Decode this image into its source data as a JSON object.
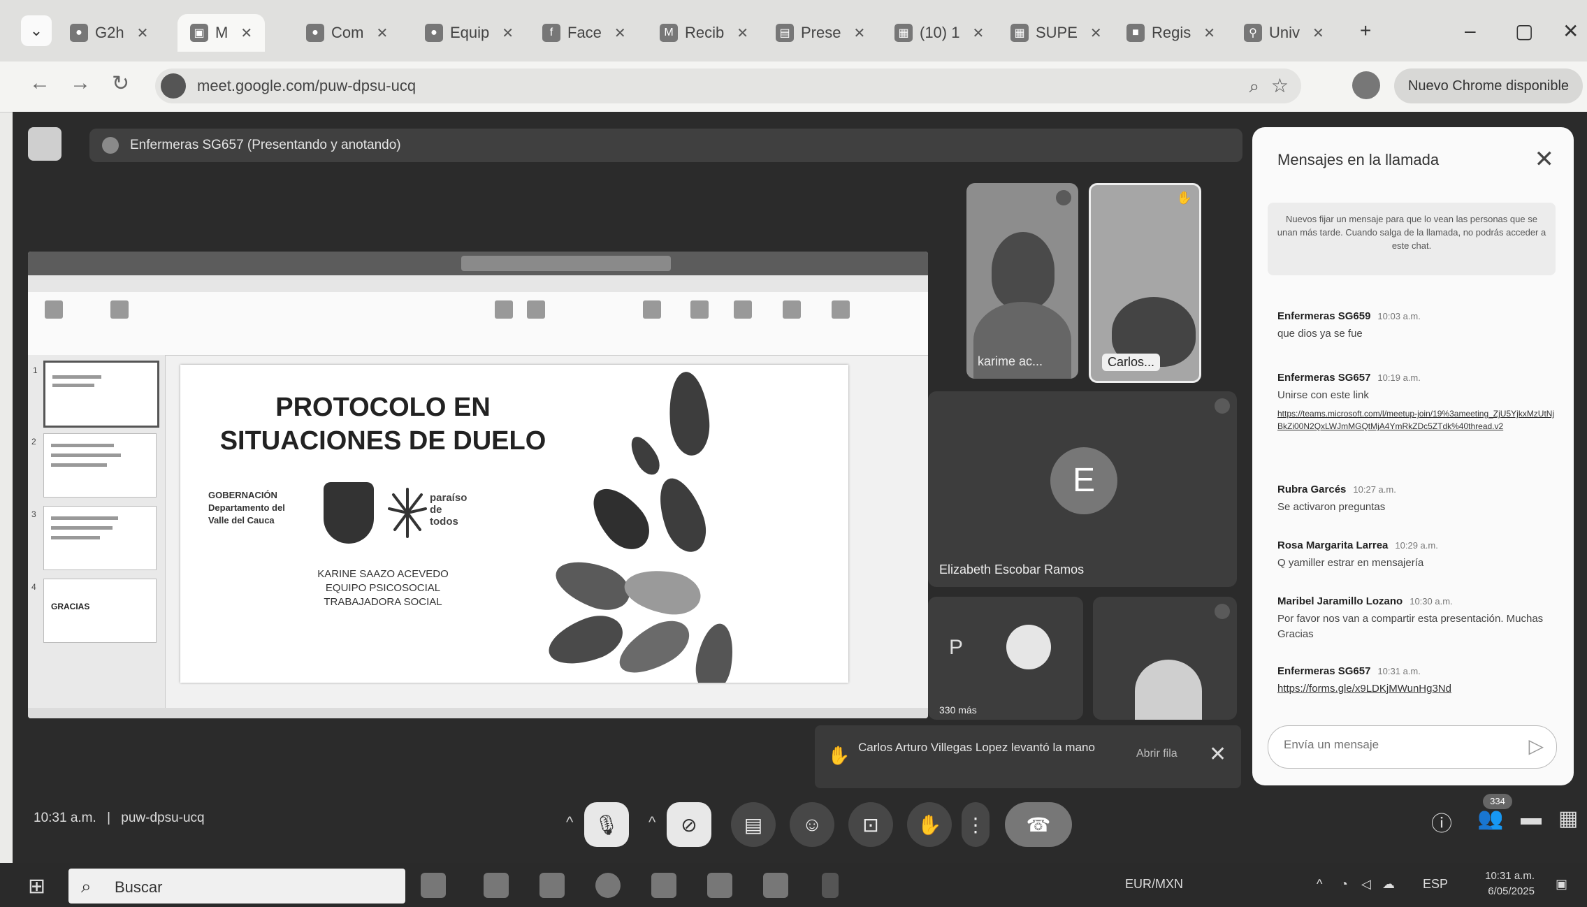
{
  "browser": {
    "tabs": [
      {
        "label": "G2h",
        "icon": "generic-tab-icon"
      },
      {
        "label": "M",
        "icon": "meet-icon",
        "active": true
      },
      {
        "label": "Com",
        "icon": "generic-tab-icon"
      },
      {
        "label": "Equip",
        "icon": "generic-tab-icon"
      },
      {
        "label": "Face",
        "icon": "facebook-icon"
      },
      {
        "label": "Recib",
        "icon": "gmail-icon"
      },
      {
        "label": "Prese",
        "icon": "slides-icon"
      },
      {
        "label": "(10) 1",
        "icon": "generic-tab-icon"
      },
      {
        "label": "SUPE",
        "icon": "generic-tab-icon"
      },
      {
        "label": "Regis",
        "icon": "generic-tab-icon"
      },
      {
        "label": "Univ",
        "icon": "maps-icon"
      }
    ],
    "url": "meet.google.com/puw-dpsu-ucq",
    "update_label": "Nuevo Chrome disponible"
  },
  "meet": {
    "presenting_label": "Enfermeras SG657 (Presentando y anotando)",
    "slide": {
      "title_line1": "PROTOCOLO EN",
      "title_line2": "SITUACIONES DE DUELO",
      "gob_line1": "GOBERNACIÓN",
      "gob_line2": "Departamento del",
      "gob_line3": "Valle del Cauca",
      "paraiso_line1": "paraíso",
      "paraiso_line2": "de todos",
      "credit1": "KARINE SAAZO ACEVEDO",
      "credit2": "EQUIPO PSICOSOCIAL",
      "credit3": "TRABAJADORA SOCIAL",
      "thumb4_label": "GRACIAS"
    },
    "participants": [
      {
        "name": "karime ac..."
      },
      {
        "name": "Carlos..."
      },
      {
        "name": "Elizabeth Escobar Ramos",
        "initial": "E"
      },
      {
        "name": "330 más",
        "initial": "P"
      }
    ],
    "notification": {
      "text": "Carlos Arturo Villegas Lopez levantó la mano",
      "action": "Abrir fila"
    },
    "meeting_time": "10:31 a.m.",
    "meeting_code": "puw-dpsu-ucq",
    "participant_count": "334"
  },
  "chat": {
    "title": "Mensajes en la llamada",
    "note": "Nuevos fijar un mensaje para que lo vean las personas que se unan más tarde. Cuando salga de la llamada, no podrás acceder a este chat.",
    "messages": [
      {
        "sender": "Enfermeras SG659",
        "time": "10:03 a.m.",
        "body": "que dios ya se fue"
      },
      {
        "sender": "Enfermeras SG657",
        "time": "10:19 a.m.",
        "body": "Unirse con este link",
        "link": "https://teams.microsoft.com/l/meetup-join/19%3ameeting_ZjU5YjkxMzUtNjBkZi00N2QxLWJmMGQtMjA4YmRkZDc5ZTdk%40thread.v2"
      },
      {
        "sender": "Rubra Garcés",
        "time": "10:27 a.m.",
        "body": "Se activaron preguntas"
      },
      {
        "sender": "Rosa Margarita Larrea",
        "time": "10:29 a.m.",
        "body": "Q yamiller estrar en mensajería"
      },
      {
        "sender": "Maribel Jaramillo Lozano",
        "time": "10:30 a.m.",
        "body": "Por favor nos van a compartir esta presentación. Muchas Gracias"
      },
      {
        "sender": "Enfermeras SG657",
        "time": "10:31 a.m.",
        "body": "",
        "link": "https://forms.gle/x9LDKjMWunHg3Nd"
      }
    ],
    "input_placeholder": "Envía un mensaje"
  },
  "taskbar": {
    "search_placeholder": "Buscar",
    "currency": "EUR/MXN",
    "lang": "ESP",
    "time": "10:31 a.m.",
    "date": "6/05/2025"
  },
  "colors": {
    "meet_bg": "#2b2b2b",
    "chat_bg": "#fafafa",
    "end_call": "#777777"
  }
}
